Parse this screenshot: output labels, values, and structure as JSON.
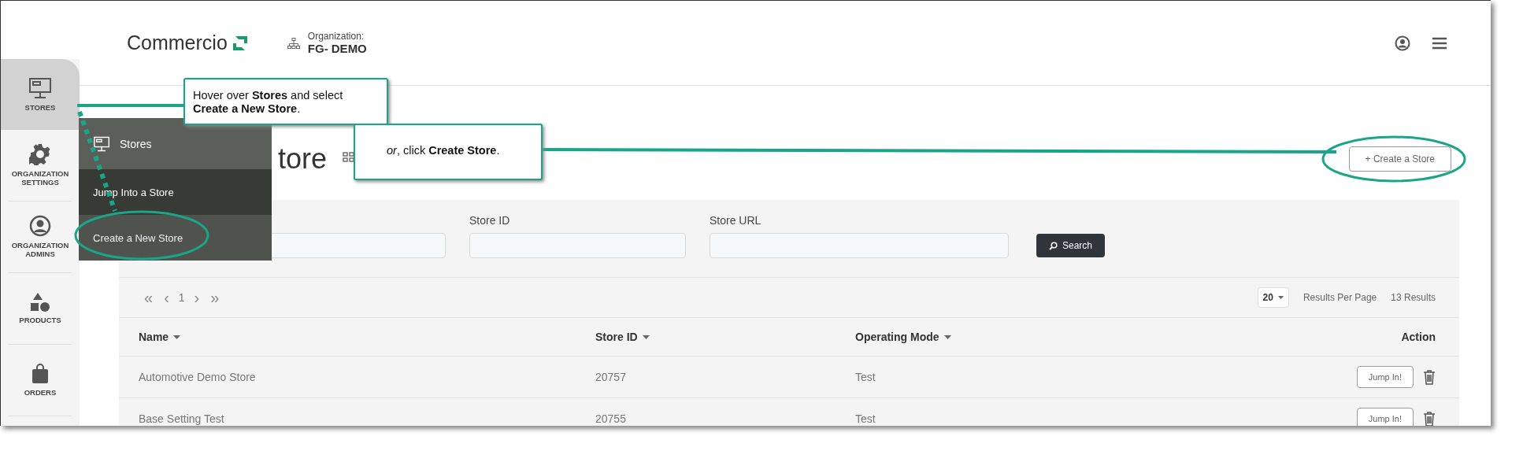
{
  "header": {
    "logo": "Commercio",
    "org_label": "Organization:",
    "org_name": "FG- DEMO"
  },
  "sidebar": {
    "items": [
      {
        "label": "STORES",
        "selected": true
      },
      {
        "label": "ORGANIZATION SETTINGS",
        "selected": false
      },
      {
        "label": "ORGANIZATION ADMINS",
        "selected": false
      },
      {
        "label": "PRODUCTS",
        "selected": false
      },
      {
        "label": "ORDERS",
        "selected": false
      }
    ]
  },
  "flyout": {
    "title": "Stores",
    "items": [
      {
        "label": "Jump Into a Store",
        "hovered": true
      },
      {
        "label": "Create a New Store",
        "hovered": false
      }
    ]
  },
  "page": {
    "title": "tore",
    "create_button": "+ Create a Store"
  },
  "filters": {
    "fields": [
      {
        "label": "Store ID"
      },
      {
        "label": "Store URL"
      }
    ],
    "search_button": "Search"
  },
  "pagination": {
    "first": "«",
    "prev": "‹",
    "page": "1",
    "next": "›",
    "last": "»",
    "per_page": "20",
    "per_page_label": "Results Per Page",
    "results": "13 Results"
  },
  "table": {
    "columns": [
      {
        "label": "Name",
        "sortable": true
      },
      {
        "label": "Store ID",
        "sortable": true
      },
      {
        "label": "Operating Mode",
        "sortable": true
      },
      {
        "label": "Action",
        "sortable": false
      }
    ],
    "rows": [
      {
        "name": "Automotive Demo Store",
        "store_id": "20757",
        "mode": "Test",
        "action": "Jump In!"
      },
      {
        "name": "Base Setting Test",
        "store_id": "20755",
        "mode": "Test",
        "action": "Jump In!"
      }
    ]
  },
  "callouts": [
    {
      "text": "Hover over **Stores** and select **Create a New Store**."
    },
    {
      "text": "*or*, click **Create Store**."
    }
  ]
}
